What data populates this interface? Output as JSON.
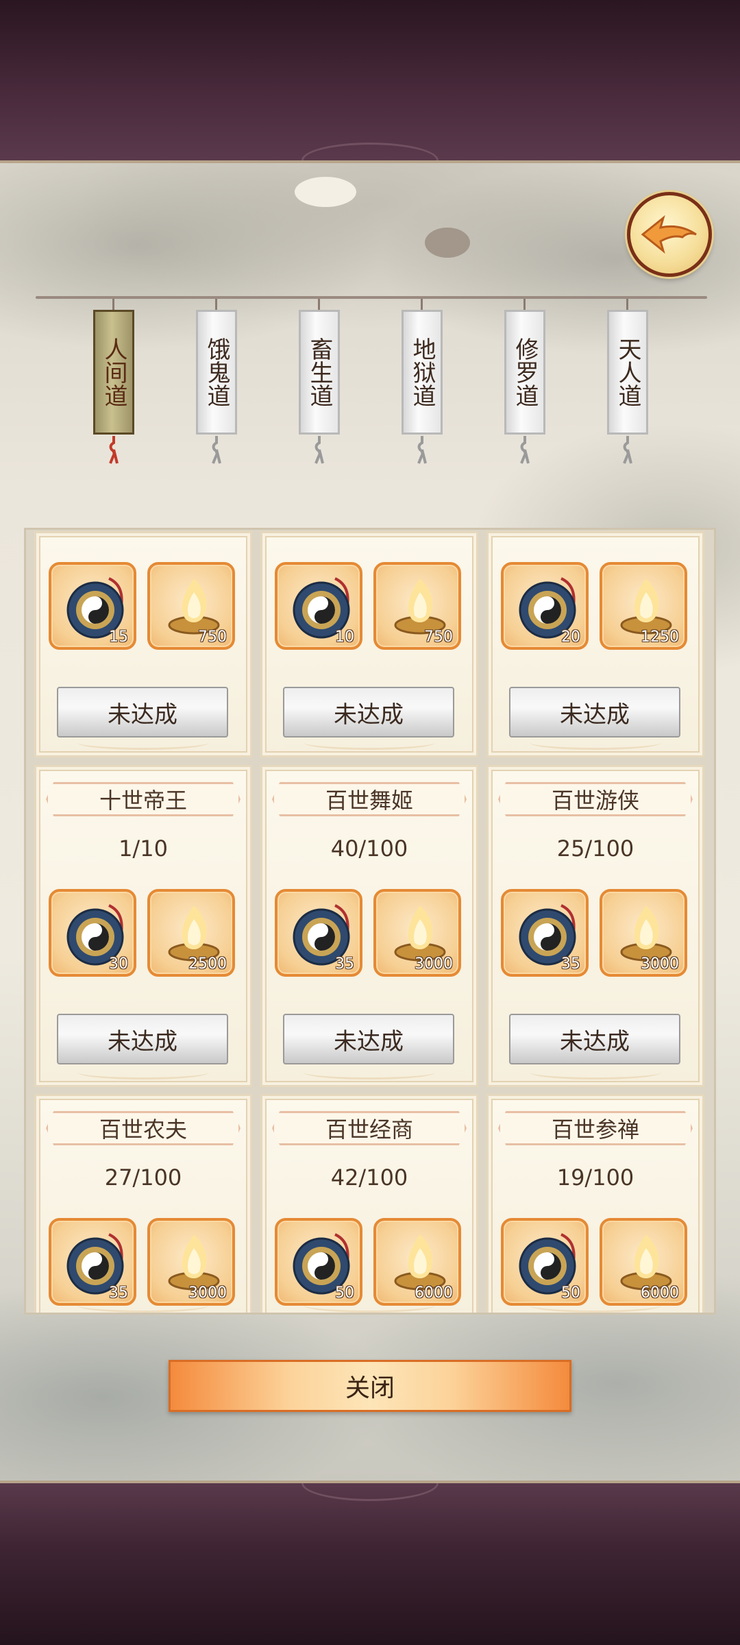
{
  "tabs": [
    {
      "label": "人间道",
      "active": true
    },
    {
      "label": "饿鬼道",
      "active": false
    },
    {
      "label": "畜生道",
      "active": false
    },
    {
      "label": "地狱道",
      "active": false
    },
    {
      "label": "修罗道",
      "active": false
    },
    {
      "label": "天人道",
      "active": false
    }
  ],
  "cards": [
    {
      "title": "",
      "progress": "",
      "rewards": [
        {
          "icon": "bagua-compass-icon",
          "count": "15"
        },
        {
          "icon": "spirit-flame-icon",
          "count": "750"
        }
      ],
      "status": "未达成"
    },
    {
      "title": "",
      "progress": "",
      "rewards": [
        {
          "icon": "bagua-compass-icon",
          "count": "10"
        },
        {
          "icon": "spirit-flame-icon",
          "count": "750"
        }
      ],
      "status": "未达成"
    },
    {
      "title": "",
      "progress": "",
      "rewards": [
        {
          "icon": "bagua-compass-icon",
          "count": "20"
        },
        {
          "icon": "spirit-flame-icon",
          "count": "1250"
        }
      ],
      "status": "未达成"
    },
    {
      "title": "十世帝王",
      "progress": "1/10",
      "rewards": [
        {
          "icon": "bagua-compass-icon",
          "count": "30"
        },
        {
          "icon": "spirit-flame-icon",
          "count": "2500"
        }
      ],
      "status": "未达成"
    },
    {
      "title": "百世舞姬",
      "progress": "40/100",
      "rewards": [
        {
          "icon": "bagua-compass-icon",
          "count": "35"
        },
        {
          "icon": "spirit-flame-icon",
          "count": "3000"
        }
      ],
      "status": "未达成"
    },
    {
      "title": "百世游侠",
      "progress": "25/100",
      "rewards": [
        {
          "icon": "bagua-compass-icon",
          "count": "35"
        },
        {
          "icon": "spirit-flame-icon",
          "count": "3000"
        }
      ],
      "status": "未达成"
    },
    {
      "title": "百世农夫",
      "progress": "27/100",
      "rewards": [
        {
          "icon": "bagua-compass-icon",
          "count": "35"
        },
        {
          "icon": "spirit-flame-icon",
          "count": "3000"
        }
      ],
      "status": ""
    },
    {
      "title": "百世经商",
      "progress": "42/100",
      "rewards": [
        {
          "icon": "bagua-compass-icon",
          "count": "50"
        },
        {
          "icon": "spirit-flame-icon",
          "count": "6000"
        }
      ],
      "status": ""
    },
    {
      "title": "百世参禅",
      "progress": "19/100",
      "rewards": [
        {
          "icon": "bagua-compass-icon",
          "count": "50"
        },
        {
          "icon": "spirit-flame-icon",
          "count": "6000"
        }
      ],
      "status": ""
    }
  ],
  "close_label": "关闭",
  "colors": {
    "accent": "#e58a35",
    "maroon": "#4a2b3d",
    "active_tab": "#c9c08e"
  }
}
